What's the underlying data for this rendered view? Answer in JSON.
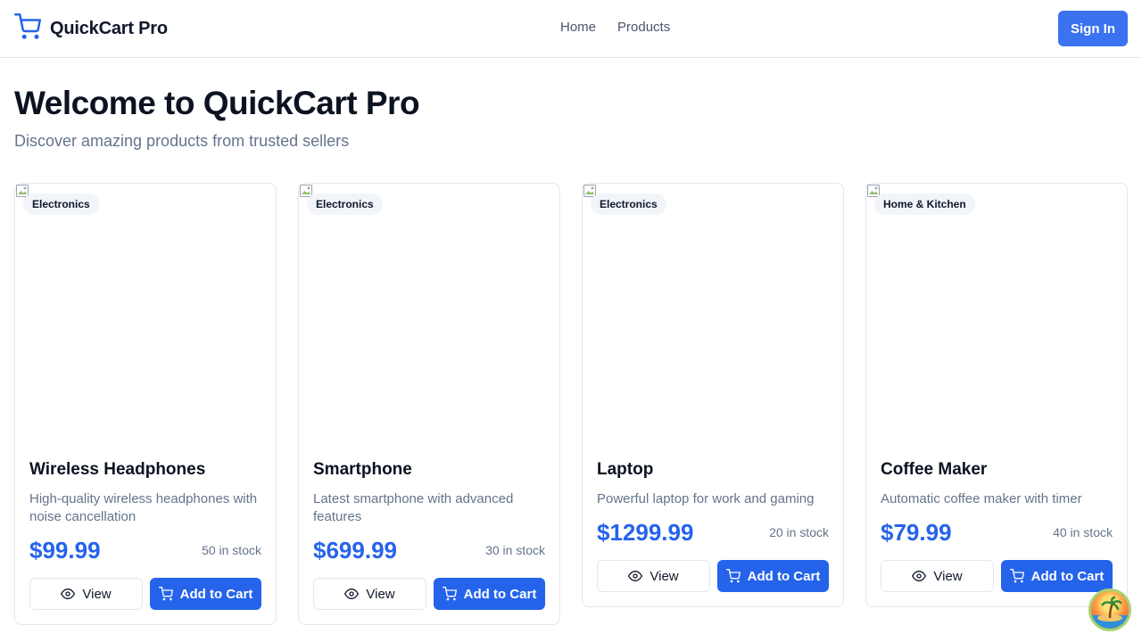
{
  "header": {
    "brand": "QuickCart Pro",
    "brand_icon": "cart-icon",
    "nav": [
      "Home",
      "Products"
    ],
    "signin_label": "Sign In",
    "accent": "#3b72f0"
  },
  "hero": {
    "title": "Welcome to QuickCart Pro",
    "subtitle": "Discover amazing products from trusted sellers"
  },
  "products": [
    {
      "category": "Electronics",
      "name": "Wireless Headphones",
      "description": "High-quality wireless headphones with noise cancellation",
      "price": "$99.99",
      "stock": "50 in stock"
    },
    {
      "category": "Electronics",
      "name": "Smartphone",
      "description": "Latest smartphone with advanced features",
      "price": "$699.99",
      "stock": "30 in stock"
    },
    {
      "category": "Electronics",
      "name": "Laptop",
      "description": "Powerful laptop for work and gaming",
      "price": "$1299.99",
      "stock": "20 in stock"
    },
    {
      "category": "Home & Kitchen",
      "name": "Coffee Maker",
      "description": "Automatic coffee maker with timer",
      "price": "$79.99",
      "stock": "40 in stock"
    }
  ],
  "card_actions": {
    "view_label": "View",
    "view_icon": "eye-icon",
    "cart_label": "Add to Cart",
    "cart_icon": "cart-icon"
  },
  "colors": {
    "price": "#2563eb",
    "primary_button": "#2563eb",
    "muted_text": "#64748b"
  }
}
